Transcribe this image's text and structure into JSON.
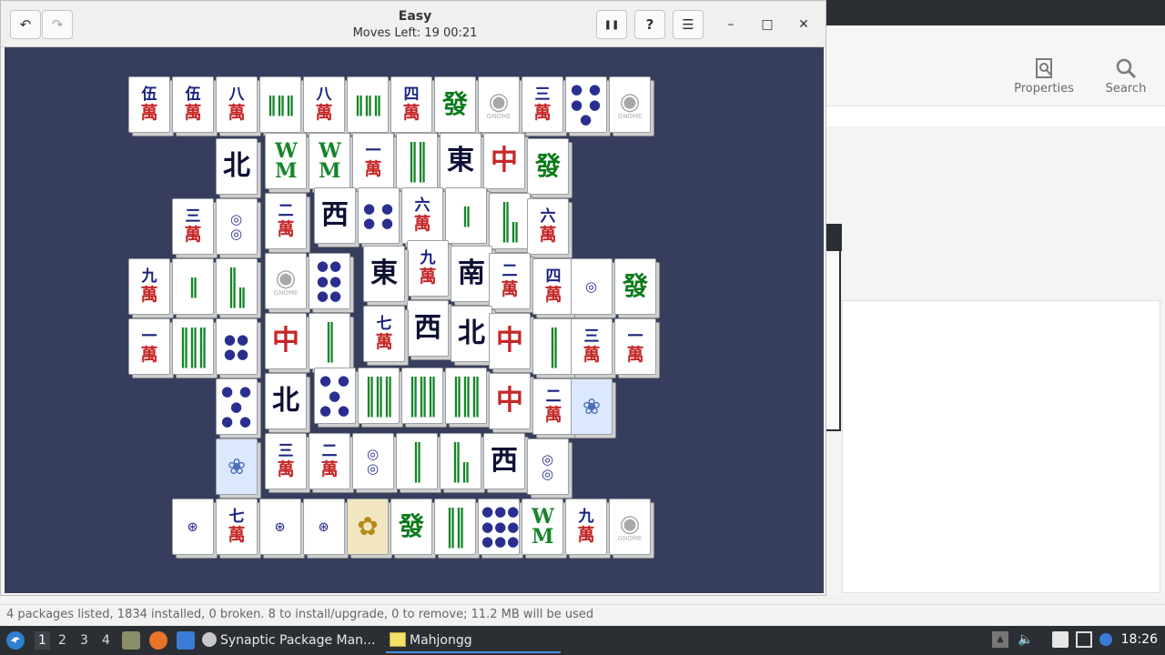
{
  "synaptic": {
    "toolbar": [
      {
        "label": "Properties",
        "icon": "properties-icon"
      },
      {
        "label": "Search",
        "icon": "search-icon"
      }
    ],
    "status": "4 packages listed, 1834 installed, 0 broken. 8 to install/upgrade, 0 to remove; 11.2 MB will be used"
  },
  "mahjongg": {
    "title": "Easy",
    "subtitle": "Moves Left: 19   00:21",
    "buttons": {
      "undo": "↶",
      "redo": "↷",
      "pause": "❚❚",
      "hint": "?",
      "menu": "☰",
      "minimize": "–",
      "maximize": "□",
      "close": "✕"
    },
    "tiles": [
      {
        "kind": "wan",
        "top": "伍",
        "bot": "萬"
      },
      {
        "kind": "wan",
        "top": "伍",
        "bot": "萬"
      },
      {
        "kind": "wan",
        "top": "八",
        "bot": "萬"
      },
      {
        "kind": "bam",
        "big": "‖‖‖"
      },
      {
        "kind": "wan",
        "top": "八",
        "bot": "萬"
      },
      {
        "kind": "bam",
        "big": "‖‖‖"
      },
      {
        "kind": "wan",
        "top": "四",
        "bot": "萬"
      },
      {
        "kind": "green",
        "big": "發"
      },
      {
        "kind": "gnome",
        "big": "◉",
        "small": "GNOME"
      },
      {
        "kind": "wan",
        "top": "三",
        "bot": "萬"
      },
      {
        "kind": "dot",
        "big": "● ●\n● ●\n●"
      },
      {
        "kind": "gnome",
        "big": "◉",
        "small": "GNOME"
      },
      {
        "kind": "wind",
        "big": "北"
      },
      {
        "kind": "bam",
        "big": "W\nM"
      },
      {
        "kind": "bam",
        "big": "W\nM"
      },
      {
        "kind": "wan",
        "top": "一",
        "bot": "萬"
      },
      {
        "kind": "bam",
        "big": "‖‖\n‖‖"
      },
      {
        "kind": "wind",
        "big": "東"
      },
      {
        "kind": "red",
        "big": "中"
      },
      {
        "kind": "green",
        "big": "發"
      },
      {
        "kind": "wan",
        "top": "三",
        "bot": "萬"
      },
      {
        "kind": "dot",
        "big": "◎\n◎"
      },
      {
        "kind": "wan",
        "top": "二",
        "bot": "萬"
      },
      {
        "kind": "wind",
        "big": "西"
      },
      {
        "kind": "dot",
        "big": "● ●\n● ●"
      },
      {
        "kind": "wan",
        "top": "六",
        "bot": "萬"
      },
      {
        "kind": "bam",
        "big": "‖"
      },
      {
        "kind": "bam",
        "big": "‖\n‖‖"
      },
      {
        "kind": "wan",
        "top": "六",
        "bot": "萬"
      },
      {
        "kind": "wan",
        "top": "九",
        "bot": "萬"
      },
      {
        "kind": "bam",
        "big": "‖"
      },
      {
        "kind": "bam",
        "big": "‖\n‖‖"
      },
      {
        "kind": "gnome",
        "big": "◉",
        "small": "GNOME"
      },
      {
        "kind": "dot",
        "big": "●●\n●●\n●●"
      },
      {
        "kind": "wind",
        "big": "東"
      },
      {
        "kind": "wan",
        "top": "九",
        "bot": "萬"
      },
      {
        "kind": "wind",
        "big": "南"
      },
      {
        "kind": "wan",
        "top": "二",
        "bot": "萬"
      },
      {
        "kind": "wan",
        "top": "四",
        "bot": "萬"
      },
      {
        "kind": "dot",
        "big": "◎"
      },
      {
        "kind": "green",
        "big": "發"
      },
      {
        "kind": "wan",
        "top": "一",
        "bot": "萬"
      },
      {
        "kind": "bam",
        "big": "‖‖‖\n‖‖‖"
      },
      {
        "kind": "dot",
        "big": "●●\n●●"
      },
      {
        "kind": "red",
        "big": "中"
      },
      {
        "kind": "bam",
        "big": "‖\n‖"
      },
      {
        "kind": "wan",
        "top": "七",
        "bot": "萬"
      },
      {
        "kind": "wind",
        "big": "西"
      },
      {
        "kind": "wind",
        "big": "北"
      },
      {
        "kind": "red",
        "big": "中"
      },
      {
        "kind": "bam",
        "big": "‖\n‖"
      },
      {
        "kind": "wan",
        "top": "三",
        "bot": "萬"
      },
      {
        "kind": "wan",
        "top": "一",
        "bot": "萬"
      },
      {
        "kind": "dot",
        "big": "● ●\n●\n● ●"
      },
      {
        "kind": "wind",
        "big": "北"
      },
      {
        "kind": "dot",
        "big": "● ●\n●\n● ●"
      },
      {
        "kind": "bam",
        "big": "‖‖‖\n‖‖‖"
      },
      {
        "kind": "bam",
        "big": "‖‖‖\n‖‖‖"
      },
      {
        "kind": "bam",
        "big": "‖‖‖\n‖‖‖"
      },
      {
        "kind": "red",
        "big": "中"
      },
      {
        "kind": "wan",
        "top": "二",
        "bot": "萬"
      },
      {
        "kind": "season",
        "big": "❀"
      },
      {
        "kind": "season",
        "big": "❀"
      },
      {
        "kind": "wan",
        "top": "三",
        "bot": "萬"
      },
      {
        "kind": "wan",
        "top": "二",
        "bot": "萬"
      },
      {
        "kind": "dot",
        "big": "◎\n◎"
      },
      {
        "kind": "bam",
        "big": "‖\n‖"
      },
      {
        "kind": "bam",
        "big": "‖\n‖‖"
      },
      {
        "kind": "wind",
        "big": "西"
      },
      {
        "kind": "dot",
        "big": "◎\n◎"
      },
      {
        "kind": "dot",
        "big": "⊛"
      },
      {
        "kind": "wan",
        "top": "七",
        "bot": "萬"
      },
      {
        "kind": "dot",
        "big": "⊛"
      },
      {
        "kind": "dot",
        "big": "⊛"
      },
      {
        "kind": "flower",
        "big": "✿"
      },
      {
        "kind": "green",
        "big": "發"
      },
      {
        "kind": "bam",
        "big": "‖‖\n‖‖"
      },
      {
        "kind": "dot",
        "big": "●●●\n●●●\n●●●"
      },
      {
        "kind": "bam",
        "big": "W\nM"
      },
      {
        "kind": "wan",
        "top": "九",
        "bot": "萬"
      },
      {
        "kind": "gnome",
        "big": "◉",
        "small": "GNOME"
      },
      {
        "kind": "bam",
        "big": "‖‖‖\n‖‖‖"
      }
    ]
  },
  "taskbar": {
    "workspaces": [
      "1",
      "2",
      "3",
      "4"
    ],
    "tasks": [
      {
        "label": "Synaptic Package Man...",
        "icon": "synaptic-icon"
      },
      {
        "label": "Mahjongg",
        "icon": "mahjongg-icon"
      }
    ],
    "clock": "18:26"
  }
}
